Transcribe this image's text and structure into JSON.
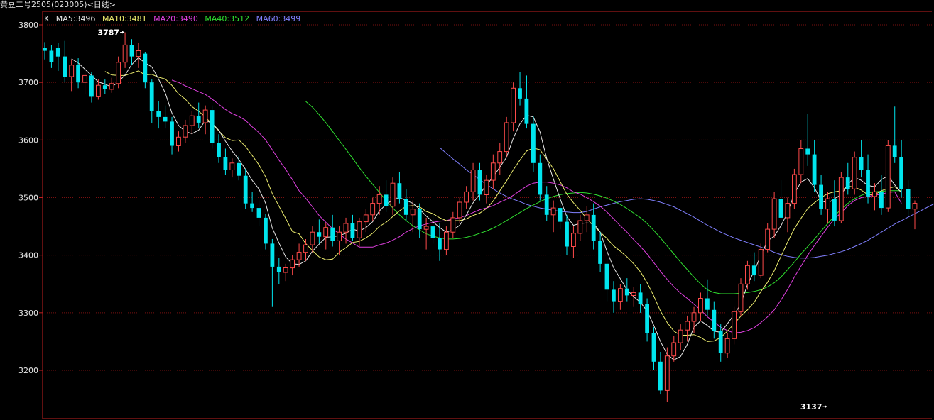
{
  "header": {
    "title": "黄豆二号2505(023005)<日线>"
  },
  "legend": {
    "k_label": "K",
    "items": [
      {
        "label": "MA5:3496",
        "color": "#e8e8e8"
      },
      {
        "label": "MA10:3481",
        "color": "#f0f070"
      },
      {
        "label": "MA20:3490",
        "color": "#e040e0"
      },
      {
        "label": "MA40:3512",
        "color": "#30e030"
      },
      {
        "label": "MA60:3499",
        "color": "#8080ff"
      }
    ]
  },
  "chart_data": {
    "type": "candlestick",
    "ylim": [
      3130,
      3810
    ],
    "yticks": [
      3800,
      3700,
      3600,
      3500,
      3400,
      3300,
      3200
    ],
    "grid": true,
    "colors": {
      "up": "#ff4a4a",
      "down": "#00e5ee",
      "grid": "#7a1010",
      "axis": "#c02020"
    },
    "annotations": [
      {
        "text": "3787",
        "price": 3787,
        "index": 12
      },
      {
        "text": "3137",
        "price": 3137,
        "index": 117
      }
    ],
    "ohlc": [
      [
        3760,
        3770,
        3740,
        3755
      ],
      [
        3755,
        3765,
        3725,
        3735
      ],
      [
        3760,
        3768,
        3720,
        3745
      ],
      [
        3745,
        3772,
        3700,
        3710
      ],
      [
        3710,
        3740,
        3685,
        3730
      ],
      [
        3730,
        3742,
        3690,
        3700
      ],
      [
        3700,
        3720,
        3680,
        3712
      ],
      [
        3712,
        3718,
        3665,
        3675
      ],
      [
        3675,
        3705,
        3670,
        3695
      ],
      [
        3695,
        3705,
        3680,
        3688
      ],
      [
        3688,
        3708,
        3682,
        3698
      ],
      [
        3698,
        3745,
        3690,
        3735
      ],
      [
        3735,
        3787,
        3725,
        3765
      ],
      [
        3765,
        3775,
        3730,
        3745
      ],
      [
        3745,
        3768,
        3725,
        3755
      ],
      [
        3750,
        3752,
        3690,
        3700
      ],
      [
        3700,
        3705,
        3630,
        3650
      ],
      [
        3650,
        3668,
        3620,
        3640
      ],
      [
        3640,
        3660,
        3620,
        3632
      ],
      [
        3632,
        3640,
        3575,
        3590
      ],
      [
        3590,
        3615,
        3580,
        3605
      ],
      [
        3605,
        3635,
        3595,
        3625
      ],
      [
        3625,
        3650,
        3610,
        3642
      ],
      [
        3642,
        3665,
        3620,
        3630
      ],
      [
        3630,
        3660,
        3610,
        3652
      ],
      [
        3652,
        3660,
        3585,
        3595
      ],
      [
        3595,
        3610,
        3560,
        3570
      ],
      [
        3570,
        3585,
        3540,
        3548
      ],
      [
        3548,
        3568,
        3535,
        3560
      ],
      [
        3560,
        3572,
        3530,
        3538
      ],
      [
        3538,
        3550,
        3480,
        3490
      ],
      [
        3490,
        3510,
        3475,
        3482
      ],
      [
        3482,
        3495,
        3450,
        3465
      ],
      [
        3465,
        3472,
        3410,
        3420
      ],
      [
        3420,
        3428,
        3310,
        3380
      ],
      [
        3380,
        3395,
        3350,
        3370
      ],
      [
        3370,
        3385,
        3355,
        3378
      ],
      [
        3378,
        3400,
        3365,
        3392
      ],
      [
        3392,
        3420,
        3380,
        3405
      ],
      [
        3405,
        3428,
        3390,
        3418
      ],
      [
        3418,
        3450,
        3405,
        3440
      ],
      [
        3440,
        3462,
        3420,
        3432
      ],
      [
        3432,
        3455,
        3410,
        3448
      ],
      [
        3448,
        3470,
        3415,
        3425
      ],
      [
        3425,
        3450,
        3400,
        3440
      ],
      [
        3440,
        3465,
        3420,
        3455
      ],
      [
        3455,
        3470,
        3425,
        3430
      ],
      [
        3430,
        3465,
        3415,
        3458
      ],
      [
        3458,
        3480,
        3440,
        3470
      ],
      [
        3470,
        3500,
        3460,
        3490
      ],
      [
        3490,
        3520,
        3470,
        3505
      ],
      [
        3505,
        3530,
        3475,
        3485
      ],
      [
        3485,
        3535,
        3470,
        3525
      ],
      [
        3525,
        3545,
        3490,
        3498
      ],
      [
        3498,
        3515,
        3460,
        3470
      ],
      [
        3470,
        3495,
        3440,
        3480
      ],
      [
        3480,
        3490,
        3430,
        3445
      ],
      [
        3445,
        3465,
        3410,
        3450
      ],
      [
        3450,
        3470,
        3420,
        3430
      ],
      [
        3430,
        3455,
        3390,
        3410
      ],
      [
        3410,
        3450,
        3400,
        3440
      ],
      [
        3440,
        3475,
        3430,
        3465
      ],
      [
        3465,
        3500,
        3455,
        3492
      ],
      [
        3492,
        3520,
        3480,
        3510
      ],
      [
        3510,
        3560,
        3495,
        3548
      ],
      [
        3548,
        3560,
        3495,
        3505
      ],
      [
        3505,
        3540,
        3490,
        3530
      ],
      [
        3530,
        3575,
        3515,
        3560
      ],
      [
        3560,
        3595,
        3540,
        3580
      ],
      [
        3580,
        3640,
        3570,
        3630
      ],
      [
        3630,
        3700,
        3615,
        3690
      ],
      [
        3690,
        3718,
        3660,
        3672
      ],
      [
        3672,
        3712,
        3620,
        3628
      ],
      [
        3628,
        3642,
        3545,
        3560
      ],
      [
        3560,
        3575,
        3495,
        3505
      ],
      [
        3505,
        3520,
        3460,
        3470
      ],
      [
        3470,
        3495,
        3440,
        3482
      ],
      [
        3482,
        3500,
        3445,
        3458
      ],
      [
        3458,
        3470,
        3400,
        3415
      ],
      [
        3415,
        3450,
        3395,
        3438
      ],
      [
        3438,
        3470,
        3425,
        3460
      ],
      [
        3460,
        3485,
        3440,
        3470
      ],
      [
        3470,
        3490,
        3410,
        3425
      ],
      [
        3425,
        3440,
        3370,
        3385
      ],
      [
        3385,
        3395,
        3320,
        3340
      ],
      [
        3340,
        3355,
        3300,
        3320
      ],
      [
        3320,
        3350,
        3305,
        3342
      ],
      [
        3342,
        3360,
        3320,
        3330
      ],
      [
        3330,
        3345,
        3310,
        3335
      ],
      [
        3335,
        3350,
        3300,
        3315
      ],
      [
        3315,
        3325,
        3250,
        3265
      ],
      [
        3265,
        3275,
        3200,
        3215
      ],
      [
        3215,
        3232,
        3158,
        3165
      ],
      [
        3165,
        3240,
        3145,
        3225
      ],
      [
        3225,
        3260,
        3215,
        3248
      ],
      [
        3248,
        3280,
        3235,
        3270
      ],
      [
        3270,
        3295,
        3250,
        3285
      ],
      [
        3285,
        3310,
        3265,
        3300
      ],
      [
        3300,
        3335,
        3285,
        3325
      ],
      [
        3325,
        3358,
        3295,
        3305
      ],
      [
        3305,
        3320,
        3255,
        3268
      ],
      [
        3268,
        3280,
        3215,
        3230
      ],
      [
        3230,
        3265,
        3222,
        3255
      ],
      [
        3255,
        3310,
        3245,
        3302
      ],
      [
        3302,
        3360,
        3295,
        3350
      ],
      [
        3350,
        3390,
        3340,
        3382
      ],
      [
        3382,
        3405,
        3355,
        3365
      ],
      [
        3365,
        3420,
        3360,
        3410
      ],
      [
        3410,
        3455,
        3405,
        3445
      ],
      [
        3445,
        3510,
        3430,
        3498
      ],
      [
        3498,
        3530,
        3455,
        3465
      ],
      [
        3465,
        3500,
        3440,
        3490
      ],
      [
        3490,
        3550,
        3480,
        3540
      ],
      [
        3540,
        3600,
        3525,
        3585
      ],
      [
        3585,
        3645,
        3555,
        3575
      ],
      [
        3575,
        3600,
        3510,
        3522
      ],
      [
        3522,
        3540,
        3470,
        3480
      ],
      [
        3480,
        3510,
        3455,
        3498
      ],
      [
        3498,
        3530,
        3450,
        3460
      ],
      [
        3460,
        3545,
        3455,
        3535
      ],
      [
        3535,
        3560,
        3505,
        3515
      ],
      [
        3515,
        3580,
        3505,
        3570
      ],
      [
        3570,
        3600,
        3535,
        3548
      ],
      [
        3548,
        3575,
        3490,
        3502
      ],
      [
        3502,
        3525,
        3478,
        3510
      ],
      [
        3510,
        3540,
        3470,
        3482
      ],
      [
        3482,
        3600,
        3475,
        3590
      ],
      [
        3590,
        3658,
        3560,
        3570
      ],
      [
        3570,
        3600,
        3500,
        3515
      ],
      [
        3515,
        3530,
        3468,
        3480
      ],
      [
        3480,
        3495,
        3445,
        3490
      ]
    ],
    "ma5": [
      null,
      null,
      null,
      null,
      3741,
      3734,
      3723,
      3712,
      3701,
      3697,
      3692,
      3701,
      3713,
      3731,
      3743,
      3734,
      3727,
      3706,
      3682,
      3647,
      3625,
      3615,
      3611,
      3617,
      3634,
      3629,
      3617,
      3598,
      3581,
      3566,
      3549,
      3530,
      3515,
      3490,
      3447,
      3421,
      3397,
      3385,
      3384,
      3390,
      3407,
      3419,
      3431,
      3432,
      3434,
      3438,
      3445,
      3442,
      3448,
      3458,
      3477,
      3488,
      3496,
      3500,
      3495,
      3490,
      3480,
      3468,
      3458,
      3448,
      3440,
      3444,
      3452,
      3470,
      3491,
      3506,
      3522,
      3536,
      3553,
      3570,
      3603,
      3628,
      3643,
      3640,
      3614,
      3568,
      3532,
      3498,
      3467,
      3452,
      3455,
      3456,
      3455,
      3440,
      3407,
      3378,
      3359,
      3340,
      3328,
      3318,
      3303,
      3278,
      3250,
      3228,
      3218,
      3224,
      3245,
      3275,
      3286,
      3278,
      3268,
      3266,
      3281,
      3297,
      3315,
      3349,
      3372,
      3400,
      3425,
      3433,
      3451,
      3474,
      3507,
      3527,
      3533,
      3517,
      3495,
      3490,
      3498,
      3505,
      3523,
      3535,
      3530,
      3521,
      3519,
      3531,
      3538,
      3522,
      3508
    ],
    "ma10": [
      null,
      null,
      null,
      null,
      null,
      null,
      null,
      null,
      null,
      3719,
      3713,
      3712,
      3712,
      3716,
      3720,
      3713,
      3714,
      3709,
      3706,
      3695,
      3680,
      3671,
      3658,
      3650,
      3640,
      3627,
      3616,
      3604,
      3599,
      3600,
      3589,
      3573,
      3557,
      3536,
      3507,
      3485,
      3464,
      3441,
      3437,
      3420,
      3408,
      3397,
      3392,
      3393,
      3405,
      3413,
      3422,
      3424,
      3430,
      3438,
      3450,
      3457,
      3467,
      3477,
      3485,
      3486,
      3484,
      3476,
      3472,
      3465,
      3460,
      3460,
      3460,
      3463,
      3469,
      3473,
      3481,
      3494,
      3512,
      3529,
      3548,
      3565,
      3581,
      3586,
      3583,
      3567,
      3550,
      3528,
      3506,
      3491,
      3478,
      3463,
      3451,
      3440,
      3429,
      3416,
      3407,
      3397,
      3385,
      3371,
      3352,
      3329,
      3303,
      3283,
      3268,
      3261,
      3261,
      3262,
      3257,
      3250,
      3251,
      3257,
      3268,
      3281,
      3294,
      3305,
      3318,
      3337,
      3353,
      3373,
      3398,
      3423,
      3446,
      3464,
      3481,
      3491,
      3500,
      3507,
      3510,
      3512,
      3520,
      3518,
      3513,
      3505,
      3505,
      3512,
      3516,
      3519,
      3510
    ],
    "ma20": [
      null,
      null,
      null,
      null,
      null,
      null,
      null,
      null,
      null,
      null,
      null,
      null,
      null,
      null,
      null,
      null,
      null,
      null,
      null,
      3704,
      3700,
      3694,
      3689,
      3684,
      3679,
      3671,
      3662,
      3653,
      3646,
      3641,
      3634,
      3623,
      3613,
      3600,
      3583,
      3565,
      3549,
      3531,
      3512,
      3499,
      3484,
      3469,
      3457,
      3446,
      3437,
      3428,
      3421,
      3414,
      3414,
      3414,
      3418,
      3421,
      3426,
      3432,
      3440,
      3446,
      3451,
      3454,
      3457,
      3459,
      3460,
      3463,
      3465,
      3469,
      3474,
      3479,
      3482,
      3486,
      3492,
      3497,
      3504,
      3512,
      3520,
      3525,
      3527,
      3527,
      3525,
      3522,
      3517,
      3510,
      3506,
      3500,
      3493,
      3485,
      3475,
      3463,
      3451,
      3440,
      3427,
      3415,
      3402,
      3387,
      3372,
      3358,
      3345,
      3334,
      3325,
      3315,
      3305,
      3293,
      3284,
      3275,
      3269,
      3265,
      3266,
      3269,
      3274,
      3283,
      3293,
      3305,
      3322,
      3341,
      3362,
      3381,
      3400,
      3417,
      3433,
      3449,
      3463,
      3474,
      3486,
      3495,
      3500,
      3502,
      3504,
      3506,
      3509,
      3510,
      3490
    ],
    "ma40": [
      null,
      null,
      null,
      null,
      null,
      null,
      null,
      null,
      null,
      null,
      null,
      null,
      null,
      null,
      null,
      null,
      null,
      null,
      null,
      null,
      null,
      null,
      null,
      null,
      null,
      null,
      null,
      null,
      null,
      null,
      null,
      null,
      null,
      null,
      null,
      null,
      null,
      null,
      null,
      3667,
      3657,
      3644,
      3630,
      3615,
      3599,
      3584,
      3568,
      3552,
      3537,
      3523,
      3509,
      3495,
      3482,
      3470,
      3460,
      3451,
      3444,
      3437,
      3433,
      3430,
      3428,
      3428,
      3429,
      3431,
      3434,
      3438,
      3442,
      3447,
      3453,
      3460,
      3467,
      3474,
      3481,
      3487,
      3493,
      3498,
      3502,
      3505,
      3507,
      3508,
      3509,
      3508,
      3506,
      3503,
      3499,
      3494,
      3488,
      3481,
      3473,
      3465,
      3455,
      3443,
      3430,
      3416,
      3402,
      3388,
      3375,
      3362,
      3350,
      3340,
      3335,
      3333,
      3333,
      3333,
      3334,
      3335,
      3337,
      3340,
      3345,
      3352,
      3362,
      3375,
      3388,
      3402,
      3415,
      3428,
      3442,
      3455,
      3468,
      3480,
      3490,
      3498,
      3504,
      3508,
      3510,
      3511,
      3512,
      3512,
      3512
    ],
    "ma60": [
      null,
      null,
      null,
      null,
      null,
      null,
      null,
      null,
      null,
      null,
      null,
      null,
      null,
      null,
      null,
      null,
      null,
      null,
      null,
      null,
      null,
      null,
      null,
      null,
      null,
      null,
      null,
      null,
      null,
      null,
      null,
      null,
      null,
      null,
      null,
      null,
      null,
      null,
      null,
      null,
      null,
      null,
      null,
      null,
      null,
      null,
      null,
      null,
      null,
      null,
      null,
      null,
      null,
      null,
      null,
      null,
      null,
      null,
      null,
      3587,
      3577,
      3567,
      3558,
      3548,
      3540,
      3531,
      3523,
      3515,
      3508,
      3502,
      3497,
      3493,
      3488,
      3485,
      3482,
      3480,
      3478,
      3476,
      3475,
      3474,
      3474,
      3476,
      3480,
      3484,
      3487,
      3490,
      3493,
      3495,
      3497,
      3498,
      3497,
      3495,
      3492,
      3488,
      3484,
      3478,
      3472,
      3466,
      3459,
      3452,
      3446,
      3440,
      3435,
      3430,
      3426,
      3422,
      3418,
      3414,
      3410,
      3405,
      3401,
      3398,
      3396,
      3395,
      3395,
      3396,
      3398,
      3400,
      3403,
      3406,
      3410,
      3415,
      3420,
      3426,
      3433,
      3440,
      3447,
      3454,
      3460,
      3466,
      3472,
      3478,
      3484,
      3490,
      3495,
      3499,
      3499,
      3499,
      3499
    ]
  }
}
